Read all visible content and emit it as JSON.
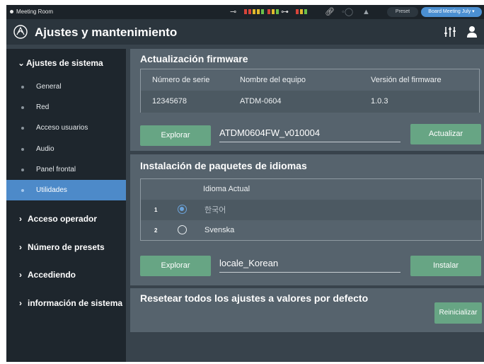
{
  "statusbar": {
    "room": "Meeting Room",
    "preset_label": "Preset",
    "preset_value": "Board Meeting July ▾"
  },
  "header": {
    "title": "Ajustes y mantenimiento"
  },
  "sidebar": {
    "system_settings": "Ajustes de sistema",
    "items": [
      {
        "label": "General"
      },
      {
        "label": "Red"
      },
      {
        "label": "Acceso usuarios"
      },
      {
        "label": "Audio"
      },
      {
        "label": "Panel frontal"
      },
      {
        "label": "Utilidades"
      }
    ],
    "sections": [
      {
        "label": "Acceso operador"
      },
      {
        "label": "Número de presets"
      },
      {
        "label": "Accediendo"
      },
      {
        "label": "información de sistema"
      }
    ]
  },
  "firmware": {
    "title": "Actualización firmware",
    "col_serial": "Número de serie",
    "col_name": "Nombre del equipo",
    "col_version": "Versión del firmware",
    "serial": "12345678",
    "name": "ATDM-0604",
    "version": "1.0.3",
    "browse_label": "Explorar",
    "file": "ATDM0604FW_v010004",
    "update_label": "Actualizar"
  },
  "language": {
    "title": "Instalación de paquetes de idiomas",
    "col_current": "Idioma Actual",
    "rows": [
      {
        "num": "1",
        "lang": "한국어"
      },
      {
        "num": "2",
        "lang": "Svenska"
      }
    ],
    "browse_label": "Explorar",
    "file": "locale_Korean",
    "install_label": "Instalar"
  },
  "reset": {
    "title": "Resetear todos los ajustes a valores por defecto",
    "button_label": "Reinicializar"
  }
}
